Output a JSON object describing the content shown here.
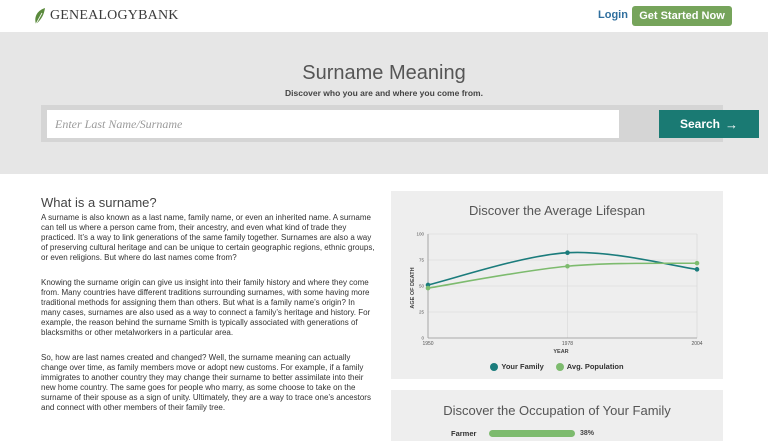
{
  "header": {
    "logo_text": "GENEALOGYBANK",
    "login_label": "Login",
    "cta_label": "Get Started Now"
  },
  "hero": {
    "title": "Surname Meaning",
    "subtitle": "Discover who you are and where you come from.",
    "search_placeholder": "Enter Last Name/Surname",
    "search_button_label": "Search",
    "search_button_icon": "arrow-right-icon"
  },
  "article": {
    "heading": "What is a surname?",
    "paragraphs": [
      "A surname is also known as a last name, family name, or even an inherited name. A surname can tell us where a person came from, their ancestry, and even what kind of trade they practiced. It’s a way to link generations of the same family together. Surnames are also a way of preserving cultural heritage and can be unique to certain geographic regions, ethnic groups, or even religions. But where do last names come from?",
      "Knowing the surname origin can give us insight into their family history and where they come from. Many countries have different traditions surrounding surnames, with some having more traditional methods for assigning them than others. But what is a family name’s origin? In many cases, surnames are also used as a way to connect a family’s heritage and history. For example, the reason behind the surname Smith is typically associated with generations of blacksmiths or other metalworkers in a particular area.",
      "So, how are last names created and changed? Well, the surname meaning can actually change over time, as family members move or adopt new customs. For example, if a family immigrates to another country they may change their surname to better assimilate into their new home country. The same goes for people who marry, as some choose to take on the surname of their spouse as a sign of unity. Ultimately, they are a way to trace one’s ancestors and connect with other members of their family tree."
    ]
  },
  "lifespan_card": {
    "title": "Discover the Average Lifespan"
  },
  "chart_data": {
    "type": "line",
    "title": "Discover the Average Lifespan",
    "xlabel": "YEAR",
    "ylabel": "AGE OF DEATH",
    "x_ticks": [
      "1950",
      "1978",
      "2004"
    ],
    "y_ticks": [
      "0",
      "25",
      "50",
      "75",
      "100"
    ],
    "xlim": [
      1950,
      2004
    ],
    "ylim": [
      0,
      100
    ],
    "grid": true,
    "legend_placement": "bottom",
    "series": [
      {
        "name": "Your Family",
        "color": "#1b7c7c",
        "x": [
          1950,
          1978,
          2004
        ],
        "y": [
          51,
          82,
          66
        ]
      },
      {
        "name": "Avg. Population",
        "color": "#7dbb6e",
        "x": [
          1950,
          1978,
          2004
        ],
        "y": [
          48,
          69,
          72
        ]
      }
    ]
  },
  "occupation_card": {
    "title": "Discover the Occupation of Your Family",
    "rows": [
      {
        "label": "Farmer",
        "percent_label": "38%",
        "color": "#7dbb6e"
      }
    ]
  }
}
